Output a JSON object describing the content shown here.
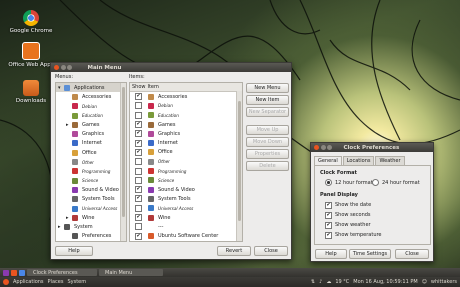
{
  "desktop": {
    "icons": [
      {
        "label": "Google Chrome",
        "icon": "chrome-icon"
      },
      {
        "label": "Office Web Apps",
        "icon": "office-icon"
      },
      {
        "label": "Downloads",
        "icon": "folder-icon"
      }
    ]
  },
  "main_menu": {
    "title": "Main Menu",
    "menus_label": "Menus:",
    "items_label": "Items:",
    "col_show": "Show",
    "col_item": "Item",
    "menus": [
      {
        "label": "Applications",
        "depth": 0,
        "expander": "▾",
        "color": "#5b8fd6"
      },
      {
        "label": "Accessories",
        "depth": 1,
        "expander": "",
        "color": "#c08a4a"
      },
      {
        "label": "Debian",
        "depth": 1,
        "expander": "",
        "color": "#c8284c",
        "small": true
      },
      {
        "label": "Education",
        "depth": 1,
        "expander": "",
        "color": "#7a9a3a",
        "small": true
      },
      {
        "label": "Games",
        "depth": 1,
        "expander": "▸",
        "color": "#9a6a3a"
      },
      {
        "label": "Graphics",
        "depth": 1,
        "expander": "",
        "color": "#b04a9a"
      },
      {
        "label": "Internet",
        "depth": 1,
        "expander": "",
        "color": "#3a6ac8"
      },
      {
        "label": "Office",
        "depth": 1,
        "expander": "",
        "color": "#d8a03a"
      },
      {
        "label": "Other",
        "depth": 1,
        "expander": "",
        "color": "#888888",
        "small": true
      },
      {
        "label": "Programming",
        "depth": 1,
        "expander": "",
        "color": "#cc3333",
        "small": true
      },
      {
        "label": "Science",
        "depth": 1,
        "expander": "",
        "color": "#6a8a3a",
        "small": true
      },
      {
        "label": "Sound & Video",
        "depth": 1,
        "expander": "",
        "color": "#8a3ab0"
      },
      {
        "label": "System Tools",
        "depth": 1,
        "expander": "",
        "color": "#666666"
      },
      {
        "label": "Universal Access",
        "depth": 1,
        "expander": "",
        "color": "#3a7ac8",
        "small": true
      },
      {
        "label": "Wine",
        "depth": 1,
        "expander": "▸",
        "color": "#b03a3a"
      },
      {
        "label": "System",
        "depth": 0,
        "expander": "▸",
        "color": "#555555"
      },
      {
        "label": "Preferences",
        "depth": 1,
        "expander": "",
        "color": "#555555"
      }
    ],
    "items": [
      {
        "label": "Accessories",
        "checked": true,
        "color": "#c08a4a"
      },
      {
        "label": "Debian",
        "checked": false,
        "color": "#c8284c",
        "small": true
      },
      {
        "label": "Education",
        "checked": false,
        "color": "#7a9a3a",
        "small": true
      },
      {
        "label": "Games",
        "checked": true,
        "color": "#9a6a3a"
      },
      {
        "label": "Graphics",
        "checked": true,
        "color": "#b04a9a"
      },
      {
        "label": "Internet",
        "checked": true,
        "color": "#3a6ac8"
      },
      {
        "label": "Office",
        "checked": true,
        "color": "#d8a03a"
      },
      {
        "label": "Other",
        "checked": false,
        "color": "#888888",
        "small": true
      },
      {
        "label": "Programming",
        "checked": false,
        "color": "#cc3333",
        "small": true
      },
      {
        "label": "Science",
        "checked": false,
        "color": "#6a8a3a",
        "small": true
      },
      {
        "label": "Sound & Video",
        "checked": true,
        "color": "#8a3ab0"
      },
      {
        "label": "System Tools",
        "checked": true,
        "color": "#666666"
      },
      {
        "label": "Universal Access",
        "checked": false,
        "color": "#3a7ac8",
        "small": true
      },
      {
        "label": "Wine",
        "checked": true,
        "color": "#b03a3a"
      },
      {
        "label": "---",
        "checked": false,
        "color": "",
        "small": false
      },
      {
        "label": "Ubuntu Software Center",
        "checked": true,
        "color": "#d85a2a"
      }
    ],
    "buttons": {
      "new_menu": "New Menu",
      "new_item": "New Item",
      "new_separator": "New Separator",
      "move_up": "Move Up",
      "move_down": "Move Down",
      "properties": "Properties",
      "delete": "Delete",
      "help": "Help",
      "revert": "Revert",
      "close": "Close"
    }
  },
  "clock_prefs": {
    "title": "Clock Preferences",
    "tabs": [
      "General",
      "Locations",
      "Weather"
    ],
    "clock_format_label": "Clock Format",
    "format_12": "12 hour format",
    "format_24": "24 hour format",
    "panel_display_label": "Panel Display",
    "options": [
      {
        "label": "Show the date",
        "checked": true
      },
      {
        "label": "Show seconds",
        "checked": true
      },
      {
        "label": "Show weather",
        "checked": true
      },
      {
        "label": "Show temperature",
        "checked": true
      }
    ],
    "buttons": {
      "help": "Help",
      "time_settings": "Time Settings",
      "close": "Close"
    }
  },
  "taskbar": {
    "tasks": [
      {
        "label": "Clock Preferences"
      },
      {
        "label": "Main Menu"
      }
    ]
  },
  "top_panel": {
    "menus": [
      "Applications",
      "Places",
      "System"
    ],
    "weather": "19 °C",
    "datetime": "Mon 16 Aug, 10:59:11 PM",
    "user": "whittakers"
  }
}
